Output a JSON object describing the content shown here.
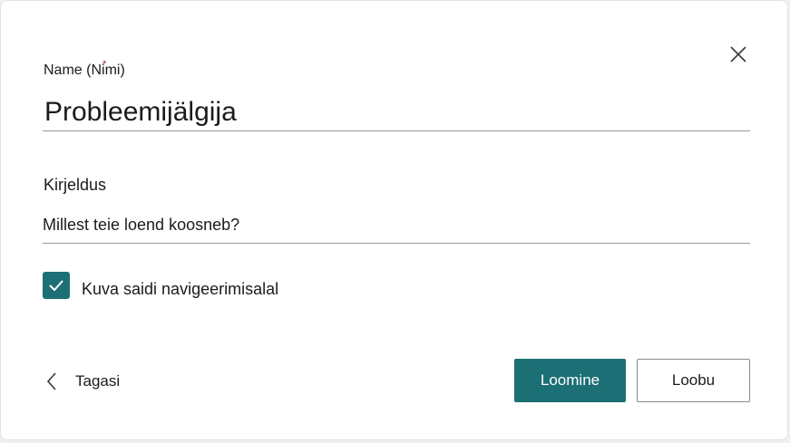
{
  "dialog": {
    "name_label": "Name (Nimi)",
    "name_value": "Probleemijälgija",
    "description_label": "Kirjeldus",
    "description_placeholder": "Millest teie loend koosneb?",
    "show_in_nav": {
      "label": "Kuva saidi navigeerimisalal",
      "checked": true
    },
    "back_label": "Tagasi",
    "create_label": "Loomine",
    "cancel_label": "Loobu",
    "icons": {
      "close": "close-icon",
      "check": "checkmark-icon",
      "back": "chevron-left-icon"
    },
    "colors": {
      "accent": "#1d6f76",
      "required": "#a4262c"
    }
  }
}
